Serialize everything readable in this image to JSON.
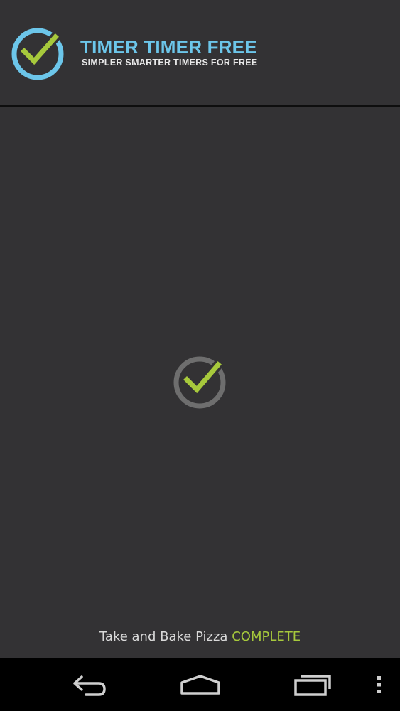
{
  "header": {
    "title": "TIMER TIMER FREE",
    "subtitle": "SIMPLER SMARTER TIMERS FOR FREE",
    "logo_icon": "check-circle-icon"
  },
  "main": {
    "status_icon": "check-circle-icon",
    "timer_name": "Take and Bake Pizza",
    "timer_state": "COMPLETE"
  },
  "navbar": {
    "buttons": [
      "back-icon",
      "home-icon",
      "recent-apps-icon",
      "overflow-menu-icon"
    ]
  },
  "colors": {
    "background": "#333234",
    "title_blue": "#6cc6ea",
    "check_green": "#a7c93c",
    "navbar": "#000000"
  }
}
